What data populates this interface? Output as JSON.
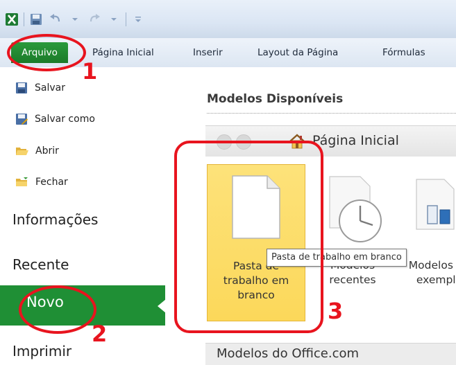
{
  "tabs": [
    "Arquivo",
    "Página Inicial",
    "Inserir",
    "Layout da Página",
    "Fórmulas"
  ],
  "menu": {
    "salvar": "Salvar",
    "salvar_como": "Salvar como",
    "abrir": "Abrir",
    "fechar": "Fechar",
    "informacoes": "Informações",
    "recente": "Recente",
    "novo": "Novo",
    "imprimir": "Imprimir"
  },
  "main": {
    "section_title": "Modelos Disponíveis",
    "nav_title": "Página Inicial",
    "tiles": [
      {
        "lines": [
          "Pasta de",
          "trabalho em",
          "branco"
        ]
      },
      {
        "lines": [
          "Modelos",
          "recentes"
        ]
      },
      {
        "lines": [
          "Modelos de",
          "exemplo"
        ]
      }
    ],
    "tooltip": "Pasta de trabalho em branco",
    "office_section": "Modelos do Office.com"
  },
  "annotations": [
    "1",
    "2",
    "3"
  ],
  "colors": {
    "accent_green": "#1f8f35",
    "tile_selected": "#fcd85a",
    "annotation_red": "#e8141e"
  }
}
